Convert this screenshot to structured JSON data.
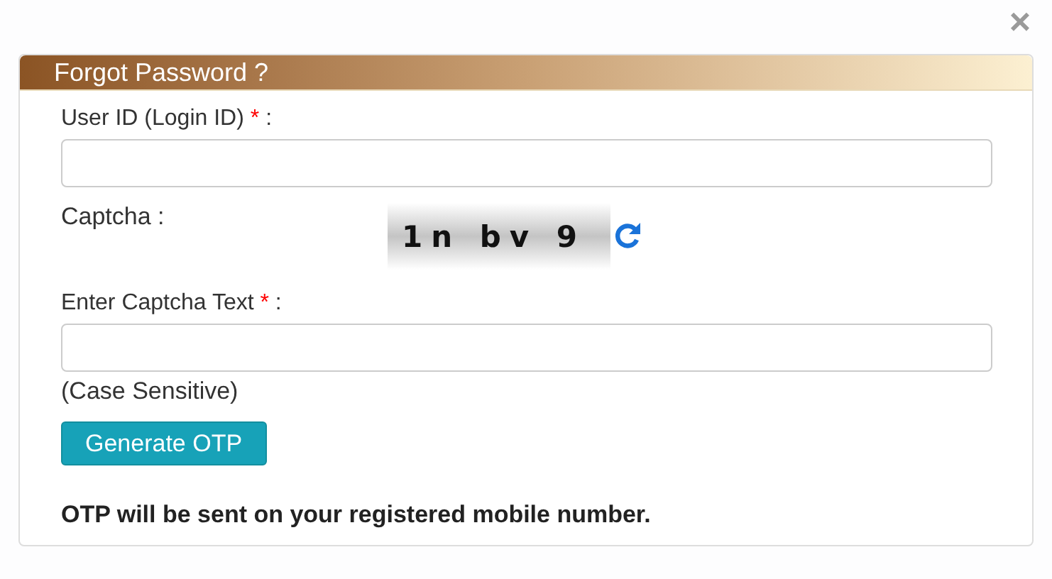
{
  "close_button": {
    "label": "×"
  },
  "panel": {
    "title": "Forgot Password ?"
  },
  "fields": [
    {
      "kind": "input",
      "label": "User ID (Login ID)",
      "required_mark": "*",
      "suffix": ":"
    },
    {
      "kind": "captcha",
      "label": "Captcha :",
      "captcha_text": "1n bv 9"
    },
    {
      "kind": "input",
      "label": "Enter Captcha Text",
      "required_mark": "*",
      "suffix": ":",
      "hint": "(Case Sensitive)"
    }
  ],
  "button": {
    "label": "Generate OTP"
  },
  "note": "OTP will be sent on your registered mobile number."
}
